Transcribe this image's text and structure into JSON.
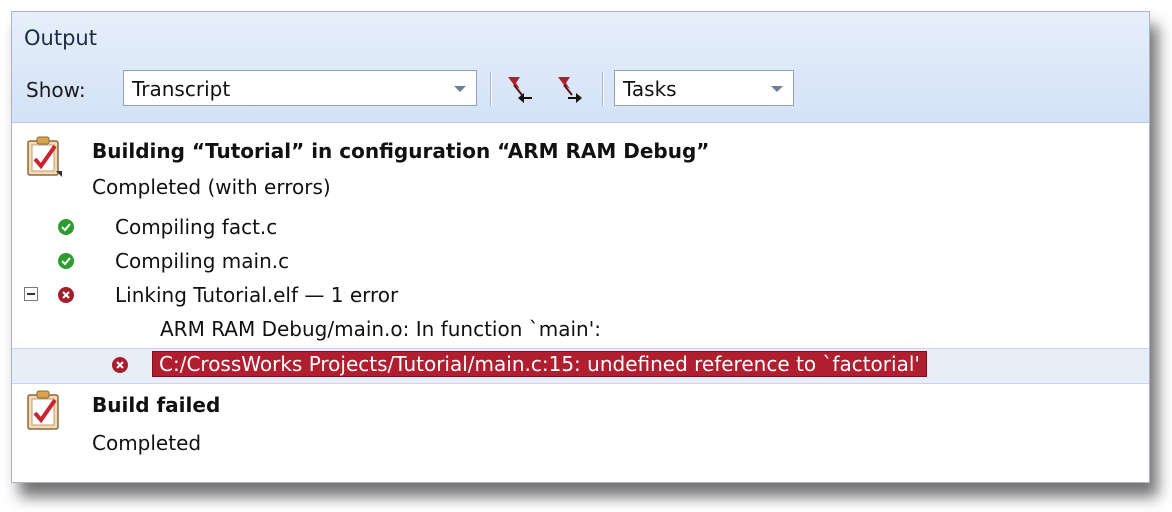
{
  "panel": {
    "title": "Output"
  },
  "toolbar": {
    "show_label": "Show:",
    "transcript_value": "Transcript",
    "tasks_value": "Tasks",
    "prev_error_icon": "previous-error-icon",
    "next_error_icon": "next-error-icon"
  },
  "build": {
    "heading": "Building “Tutorial” in configuration “ARM RAM Debug”",
    "status": "Completed (with errors)",
    "steps": [
      {
        "label": "Compiling fact.c",
        "status": "ok"
      },
      {
        "label": "Compiling main.c",
        "status": "ok"
      },
      {
        "label": "Linking Tutorial.elf — 1 error",
        "status": "error"
      }
    ],
    "link_detail": "ARM RAM Debug/main.o: In function `main':",
    "error_message": "C:/CrossWorks Projects/Tutorial/main.c:15: undefined reference to `factorial'"
  },
  "result": {
    "heading": "Build failed",
    "status": "Completed"
  },
  "colors": {
    "ok": "#2e9b2e",
    "error": "#a31d2a",
    "header_bg": "#dbe7f8",
    "selected_row": "#e8eef8"
  }
}
